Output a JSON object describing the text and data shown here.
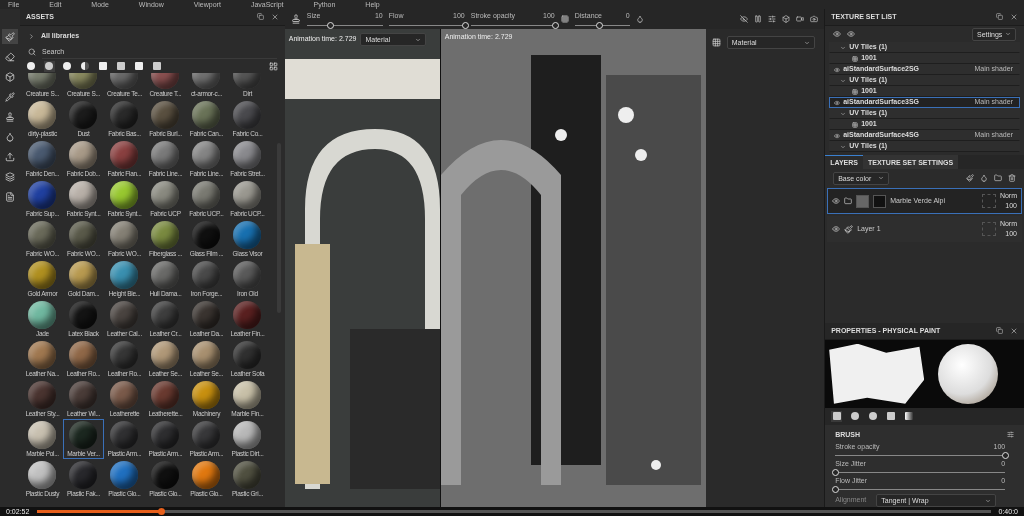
{
  "menu": [
    "File",
    "Edit",
    "Mode",
    "Window",
    "Viewport",
    "JavaScript",
    "Python",
    "Help"
  ],
  "assets": {
    "title": "ASSETS",
    "library": "All libraries",
    "search_placeholder": "Search",
    "materials": [
      {
        "name": "Creature S...",
        "color": "#7a7f70",
        "selected": false
      },
      {
        "name": "Creature S...",
        "color": "#8a8a60",
        "selected": false
      },
      {
        "name": "Creature Te...",
        "color": "#6a6a6a",
        "selected": false
      },
      {
        "name": "Creature T...",
        "color": "#8a5050",
        "selected": false
      },
      {
        "name": "ct-armor-c...",
        "color": "#707070",
        "selected": false
      },
      {
        "name": "Dirt",
        "color": "#555555",
        "selected": false
      },
      {
        "name": "dirty-plastic",
        "color": "#c8b898",
        "selected": false
      },
      {
        "name": "Dust",
        "color": "#1c1c1c",
        "selected": false
      },
      {
        "name": "Fabric Bas...",
        "color": "#2a2a2a",
        "selected": false
      },
      {
        "name": "Fabric Burl...",
        "color": "#5a5040",
        "selected": false
      },
      {
        "name": "Fabric Can...",
        "color": "#6a7358",
        "selected": false
      },
      {
        "name": "Fabric Co...",
        "color": "#4a4a4e",
        "selected": false
      },
      {
        "name": "Fabric Den...",
        "color": "#4a5a70",
        "selected": false
      },
      {
        "name": "Fabric Dob...",
        "color": "#a89a88",
        "selected": false
      },
      {
        "name": "Fabric Flan...",
        "color": "#8a4040",
        "selected": false
      },
      {
        "name": "Fabric Line...",
        "color": "#7a7a7a",
        "selected": false
      },
      {
        "name": "Fabric Line...",
        "color": "#858585",
        "selected": false
      },
      {
        "name": "Fabric Stret...",
        "color": "#8a8a8e",
        "selected": false
      },
      {
        "name": "Fabric Sup...",
        "color": "#2040a0",
        "selected": false
      },
      {
        "name": "Fabric Synt...",
        "color": "#b8b0a8",
        "selected": false
      },
      {
        "name": "Fabric Synt...",
        "color": "#98c830",
        "selected": false
      },
      {
        "name": "Fabric UCP",
        "color": "#8a8a80",
        "selected": false
      },
      {
        "name": "Fabric UCP...",
        "color": "#7a7a72",
        "selected": false
      },
      {
        "name": "Fabric UCP...",
        "color": "#9a9890",
        "selected": false
      },
      {
        "name": "Fabric WO...",
        "color": "#6a6a5a",
        "selected": false
      },
      {
        "name": "Fabric WO...",
        "color": "#5a5a4a",
        "selected": false
      },
      {
        "name": "Fabric WO...",
        "color": "#858075",
        "selected": false
      },
      {
        "name": "Fiberglass ...",
        "color": "#7a8a40",
        "selected": false
      },
      {
        "name": "Glass Film ...",
        "color": "#101010",
        "selected": false
      },
      {
        "name": "Glass Visor",
        "color": "#1870b0",
        "selected": false
      },
      {
        "name": "Gold Armor",
        "color": "#b09020",
        "selected": false
      },
      {
        "name": "Gold Dam...",
        "color": "#b89a50",
        "selected": false
      },
      {
        "name": "Height Ble...",
        "color": "#3a90b0",
        "selected": false
      },
      {
        "name": "Hull Dama...",
        "color": "#6a6a68",
        "selected": false
      },
      {
        "name": "Iron Forge...",
        "color": "#4a4a4a",
        "selected": false
      },
      {
        "name": "Iron Old",
        "color": "#5a5a5a",
        "selected": false
      },
      {
        "name": "Jade",
        "color": "#70b8a0",
        "selected": false
      },
      {
        "name": "Latex Black",
        "color": "#141414",
        "selected": false
      },
      {
        "name": "Leather Cal...",
        "color": "#4a4440",
        "selected": false
      },
      {
        "name": "Leather Cr...",
        "color": "#3e3e3e",
        "selected": false
      },
      {
        "name": "Leather Da...",
        "color": "#3a3430",
        "selected": false
      },
      {
        "name": "Leather Fin...",
        "color": "#5a2020",
        "selected": false
      },
      {
        "name": "Leather Na...",
        "color": "#a07850",
        "selected": false
      },
      {
        "name": "Leather Ro...",
        "color": "#906848",
        "selected": false
      },
      {
        "name": "Leather Ro...",
        "color": "#363636",
        "selected": false
      },
      {
        "name": "Leather Se...",
        "color": "#b09878",
        "selected": false
      },
      {
        "name": "Leather Se...",
        "color": "#a89070",
        "selected": false
      },
      {
        "name": "Leather Sofa",
        "color": "#303030",
        "selected": false
      },
      {
        "name": "Leather Sty...",
        "color": "#4a3430",
        "selected": false
      },
      {
        "name": "Leather Wi...",
        "color": "#4a3c38",
        "selected": false
      },
      {
        "name": "Leatherette",
        "color": "#7a5a4a",
        "selected": false
      },
      {
        "name": "Leatherette...",
        "color": "#6a3a30",
        "selected": false
      },
      {
        "name": "Machinery",
        "color": "#c89010",
        "selected": false
      },
      {
        "name": "Marble Fin...",
        "color": "#c8c0a8",
        "selected": false
      },
      {
        "name": "Marble Pol...",
        "color": "#c8c0b0",
        "selected": false
      },
      {
        "name": "Marble Ver...",
        "color": "#1c2820",
        "selected": true
      },
      {
        "name": "Plastic Arm...",
        "color": "#303032",
        "selected": false
      },
      {
        "name": "Plastic Arm...",
        "color": "#2e2e30",
        "selected": false
      },
      {
        "name": "Plastic Arm...",
        "color": "#38383a",
        "selected": false
      },
      {
        "name": "Plastic Dirt...",
        "color": "#b8b8b8",
        "selected": false
      },
      {
        "name": "Plastic Dusty",
        "color": "#c0c0c0",
        "selected": false
      },
      {
        "name": "Plastic Fak...",
        "color": "#28282c",
        "selected": false
      },
      {
        "name": "Plastic Glo...",
        "color": "#2070c0",
        "selected": false
      },
      {
        "name": "Plastic Glo...",
        "color": "#101010",
        "selected": false
      },
      {
        "name": "Plastic Glo...",
        "color": "#e07810",
        "selected": false
      },
      {
        "name": "Plastic Gri...",
        "color": "#505040",
        "selected": false
      }
    ]
  },
  "viewport": {
    "sliders": [
      {
        "label": "Size",
        "value": "10",
        "level": 0.3
      },
      {
        "label": "Flow",
        "value": "100",
        "level": 1
      },
      {
        "label": "Stroke opacity",
        "value": "100",
        "level": 1
      },
      {
        "label": "Distance",
        "value": "0",
        "level": 0.45
      }
    ],
    "left": {
      "animation_time": "Animation time: 2.729",
      "dropdown": "Material"
    },
    "right": {
      "animation_time": "Animation time: 2.729"
    },
    "side_dropdown": "Material"
  },
  "texture_set_list": {
    "title": "TEXTURE SET LIST",
    "settings": "Settings",
    "rows": [
      {
        "kind": "group",
        "label": "UV Tiles (1)",
        "selected": false
      },
      {
        "kind": "tile",
        "label": "1001",
        "selected": false
      },
      {
        "kind": "set",
        "label": "aiStandardSurface2SG",
        "shader": "Main shader",
        "selected": false
      },
      {
        "kind": "group",
        "label": "UV Tiles (1)",
        "selected": false
      },
      {
        "kind": "tile",
        "label": "1001",
        "selected": false
      },
      {
        "kind": "set",
        "label": "aiStandardSurface3SG",
        "shader": "Main shader",
        "selected": true
      },
      {
        "kind": "group",
        "label": "UV Tiles (1)",
        "selected": false
      },
      {
        "kind": "tile",
        "label": "1001",
        "selected": false
      },
      {
        "kind": "set",
        "label": "aiStandardSurface4SG",
        "shader": "Main shader",
        "selected": false
      },
      {
        "kind": "group",
        "label": "UV Tiles (1)",
        "selected": false
      }
    ]
  },
  "layers": {
    "tabs": [
      {
        "label": "LAYERS",
        "selected": true
      },
      {
        "label": "TEXTURE SET SETTINGS",
        "selected": false
      }
    ],
    "channel": "Base color",
    "items": [
      {
        "kind": "fill",
        "name": "Marble Verde Alpi",
        "blend": "Norm",
        "opacity": "100",
        "selected": true
      },
      {
        "kind": "paint",
        "name": "Layer 1",
        "blend": "Norm",
        "opacity": "100",
        "selected": false
      }
    ]
  },
  "properties": {
    "title": "PROPERTIES - PHYSICAL PAINT",
    "section": "BRUSH",
    "params": [
      {
        "label": "Stroke opacity",
        "value": "100",
        "level": 1
      },
      {
        "label": "Size Jitter",
        "value": "0",
        "level": 0
      },
      {
        "label": "Flow Jitter",
        "value": "0",
        "level": 0
      }
    ],
    "alignment": {
      "label": "Alignment",
      "value": "Tangent | Wrap"
    }
  },
  "video": {
    "elapsed": "0:02:52",
    "total": "0:40:0",
    "level": 0.13
  }
}
